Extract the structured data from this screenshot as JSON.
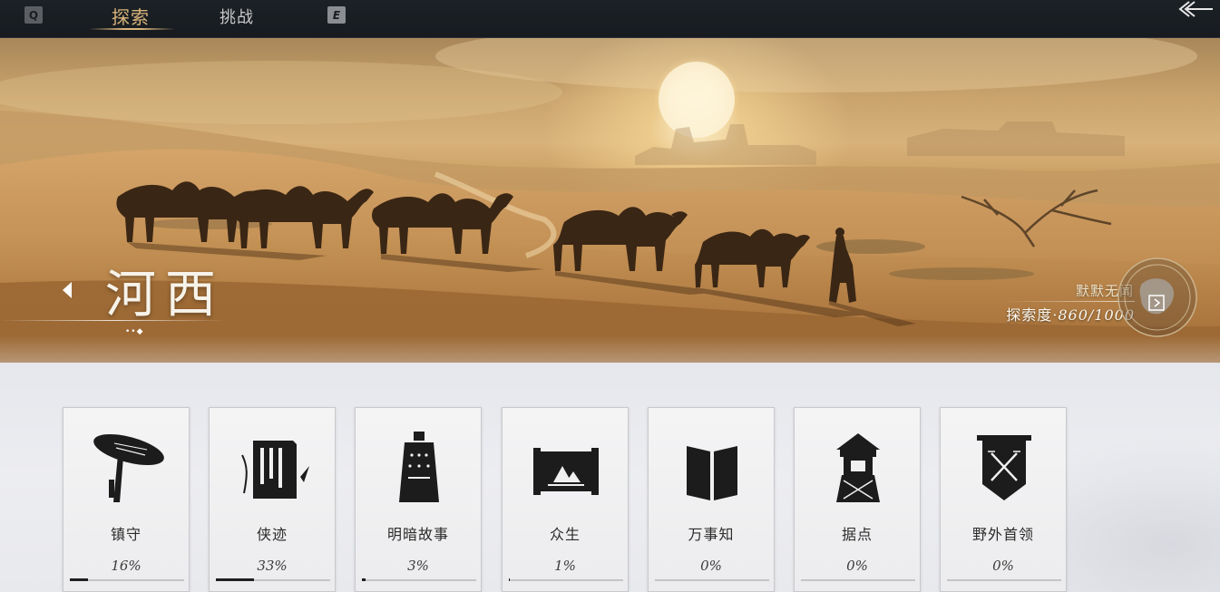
{
  "topbar": {
    "key_left": "Q",
    "key_right": "E",
    "tabs": [
      {
        "label": "探索",
        "active": true
      },
      {
        "label": "挑战",
        "active": false
      }
    ],
    "accent_color": "#d9b47a"
  },
  "banner": {
    "region_name": "河西",
    "region_dots": "••◆",
    "progress_subtitle": "默默无闻",
    "progress_label": "探索度·",
    "progress_value": "860/1000",
    "progress_current": 860,
    "progress_max": 1000
  },
  "cards": [
    {
      "label": "镇守",
      "percent_text": "16%",
      "progress": 0.16,
      "icon": "umbrella-hat-icon"
    },
    {
      "label": "侠迹",
      "percent_text": "33%",
      "progress": 0.33,
      "icon": "scroll-book-icon"
    },
    {
      "label": "明暗故事",
      "percent_text": "3%",
      "progress": 0.03,
      "icon": "bell-icon"
    },
    {
      "label": "众生",
      "percent_text": "1%",
      "progress": 0.01,
      "icon": "painting-scroll-icon"
    },
    {
      "label": "万事知",
      "percent_text": "0%",
      "progress": 0.0,
      "icon": "open-book-icon"
    },
    {
      "label": "据点",
      "percent_text": "0%",
      "progress": 0.0,
      "icon": "watchtower-icon"
    },
    {
      "label": "野外首领",
      "percent_text": "0%",
      "progress": 0.0,
      "icon": "crossed-swords-banner-icon"
    }
  ]
}
